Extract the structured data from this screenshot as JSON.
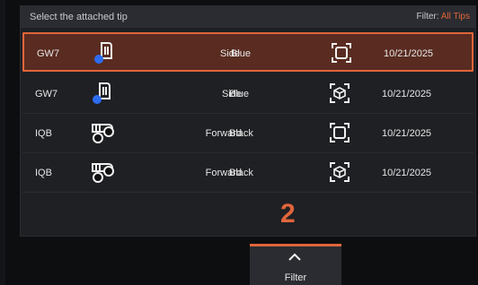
{
  "header": {
    "title": "Select the attached tip",
    "filter_label": "Filter:",
    "filter_value": "All Tips"
  },
  "rows": [
    {
      "id": "GW7",
      "view": "Side",
      "color": "Blue",
      "date": "10/21/2025",
      "tip_icon": "side-tip-blue-icon",
      "mode_icon": "2d-frame-icon",
      "selected": true
    },
    {
      "id": "GW7",
      "view": "Side",
      "color": "Blue",
      "date": "10/21/2025",
      "tip_icon": "side-tip-blue-icon",
      "mode_icon": "3d-cube-icon",
      "selected": false
    },
    {
      "id": "IQB",
      "view": "Forward",
      "color": "Black",
      "date": "10/21/2025",
      "tip_icon": "forward-tip-black-icon",
      "mode_icon": "2d-frame-icon",
      "selected": false
    },
    {
      "id": "IQB",
      "view": "Forward",
      "color": "Black",
      "date": "10/21/2025",
      "tip_icon": "forward-tip-black-icon",
      "mode_icon": "3d-cube-icon",
      "selected": false
    }
  ],
  "annotation_number": "2",
  "filter_button": {
    "label": "Filter"
  },
  "colors": {
    "accent": "#e0653a",
    "selected_row_bg": "#5a2c21",
    "panel_bg": "#1f2024",
    "header_bg": "#2b2c31"
  }
}
